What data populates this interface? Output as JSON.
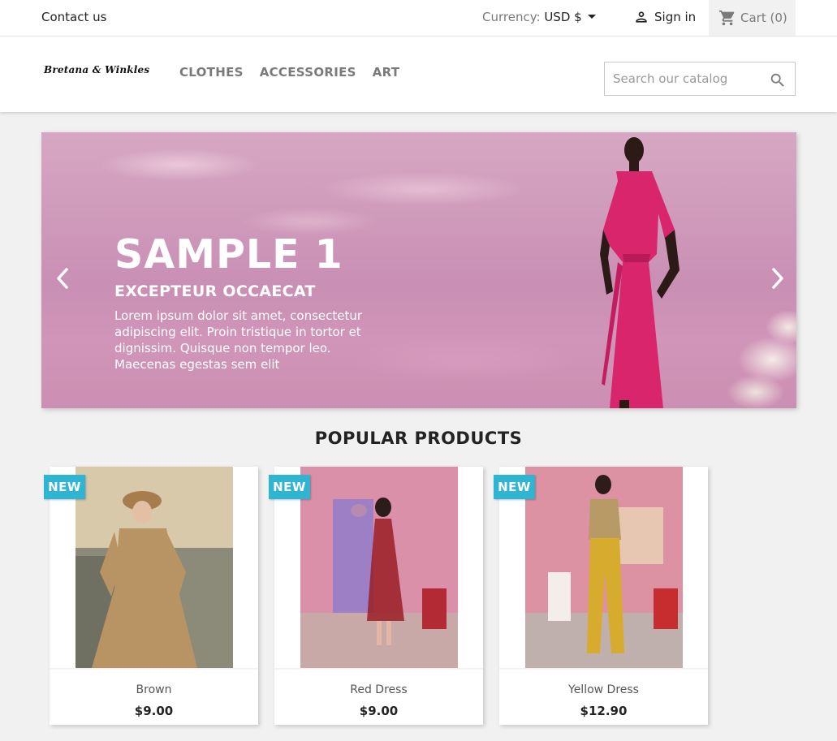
{
  "topnav": {
    "contact": "Contact us",
    "currency_label": "Currency:",
    "currency_value": "USD $",
    "sign_in": "Sign in",
    "cart": "Cart (0)"
  },
  "header": {
    "logo": "Bretana & Winkles",
    "menu": [
      "CLOTHES",
      "ACCESSORIES",
      "ART"
    ],
    "search_placeholder": "Search our catalog"
  },
  "slider": {
    "title": "SAMPLE 1",
    "subtitle": "EXCEPTEUR OCCAECAT",
    "text": "Lorem ipsum dolor sit amet, consectetur adipiscing elit. Proin tristique in tortor et dignissim. Quisque non tempor leo. Maecenas egestas sem elit"
  },
  "popular": {
    "title": "POPULAR PRODUCTS",
    "badge": "NEW",
    "products": [
      {
        "name": "Brown",
        "price": "$9.00"
      },
      {
        "name": "Red Dress",
        "price": "$9.00"
      },
      {
        "name": "Yellow Dress",
        "price": "$12.90"
      }
    ]
  },
  "colors": {
    "accent": "#2fb5d2",
    "slider_bg": "#cf9bbb"
  },
  "icons": [
    "caret-down-icon",
    "user-icon",
    "cart-icon",
    "search-icon",
    "chevron-left-icon",
    "chevron-right-icon"
  ]
}
